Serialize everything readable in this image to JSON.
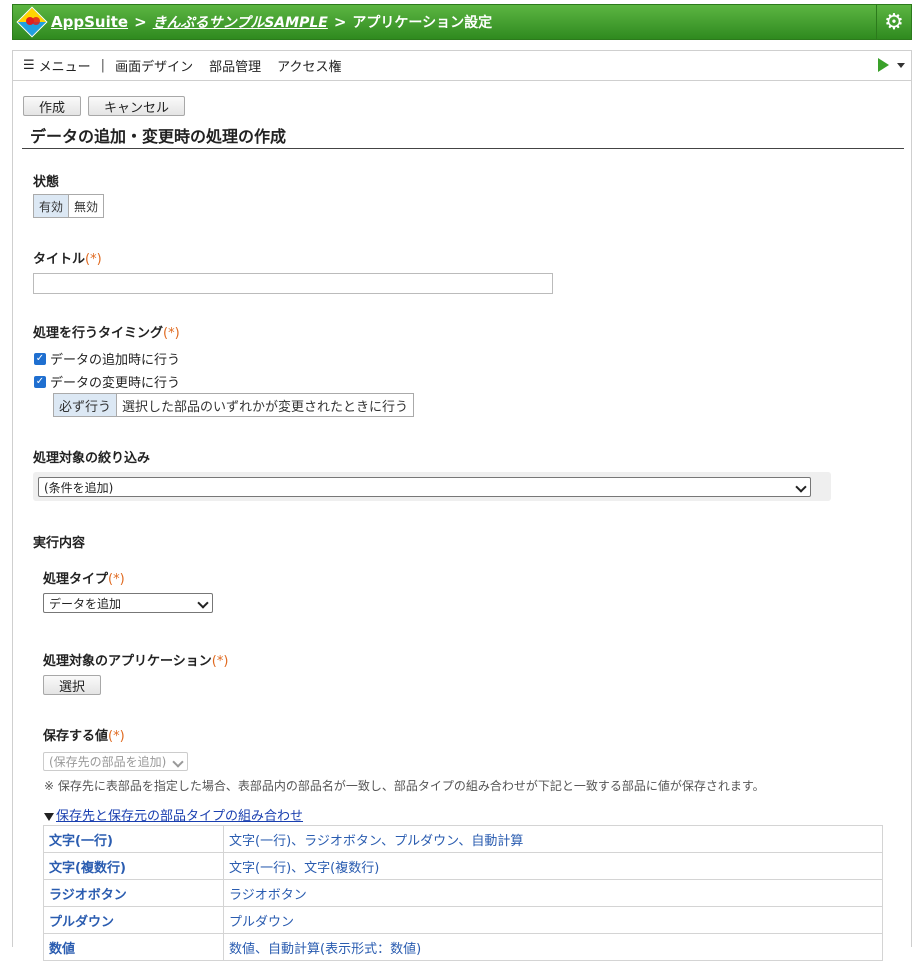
{
  "header": {
    "app_name": "AppSuite",
    "breadcrumb_sep": ">",
    "app_title": "きんぷるサンプルSAMPLE",
    "current_page": "アプリケーション設定"
  },
  "menubar": {
    "menu_label": "メニュー",
    "pipe": "|",
    "links": [
      "画面デザイン",
      "部品管理",
      "アクセス権"
    ]
  },
  "actions": {
    "create": "作成",
    "cancel": "キャンセル"
  },
  "page_title": "データの追加・変更時の処理の作成",
  "required_mark": "(*)",
  "status": {
    "label": "状態",
    "options": [
      "有効",
      "無効"
    ],
    "selected": "有効"
  },
  "title_field": {
    "label": "タイトル",
    "value": ""
  },
  "timing": {
    "label": "処理を行うタイミング",
    "on_add": "データの追加時に行う",
    "on_change": "データの変更時に行う",
    "change_options": [
      "必ず行う",
      "選択した部品のいずれかが変更されたときに行う"
    ],
    "change_selected": "必ず行う"
  },
  "filter": {
    "label": "処理対象の絞り込み",
    "select_value": "(条件を追加)"
  },
  "execution": {
    "label": "実行内容",
    "type_label": "処理タイプ",
    "type_value": "データを追加",
    "target_app_label": "処理対象のアプリケーション",
    "select_button": "選択",
    "save_values_label": "保存する値",
    "save_values_select": "(保存先の部品を追加)",
    "note": "※ 保存先に表部品を指定した場合、表部品内の部品名が一致し、部品タイプの組み合わせが下記と一致する部品に値が保存されます。",
    "combo_link": "保存先と保存元の部品タイプの組み合わせ",
    "combo_rows": [
      [
        "文字(一行)",
        "文字(一行)、ラジオボタン、プルダウン、自動計算"
      ],
      [
        "文字(複数行)",
        "文字(一行)、文字(複数行)"
      ],
      [
        "ラジオボタン",
        "ラジオボタン"
      ],
      [
        "プルダウン",
        "プルダウン"
      ],
      [
        "数値",
        "数値、自動計算(表示形式：数値)"
      ]
    ]
  }
}
